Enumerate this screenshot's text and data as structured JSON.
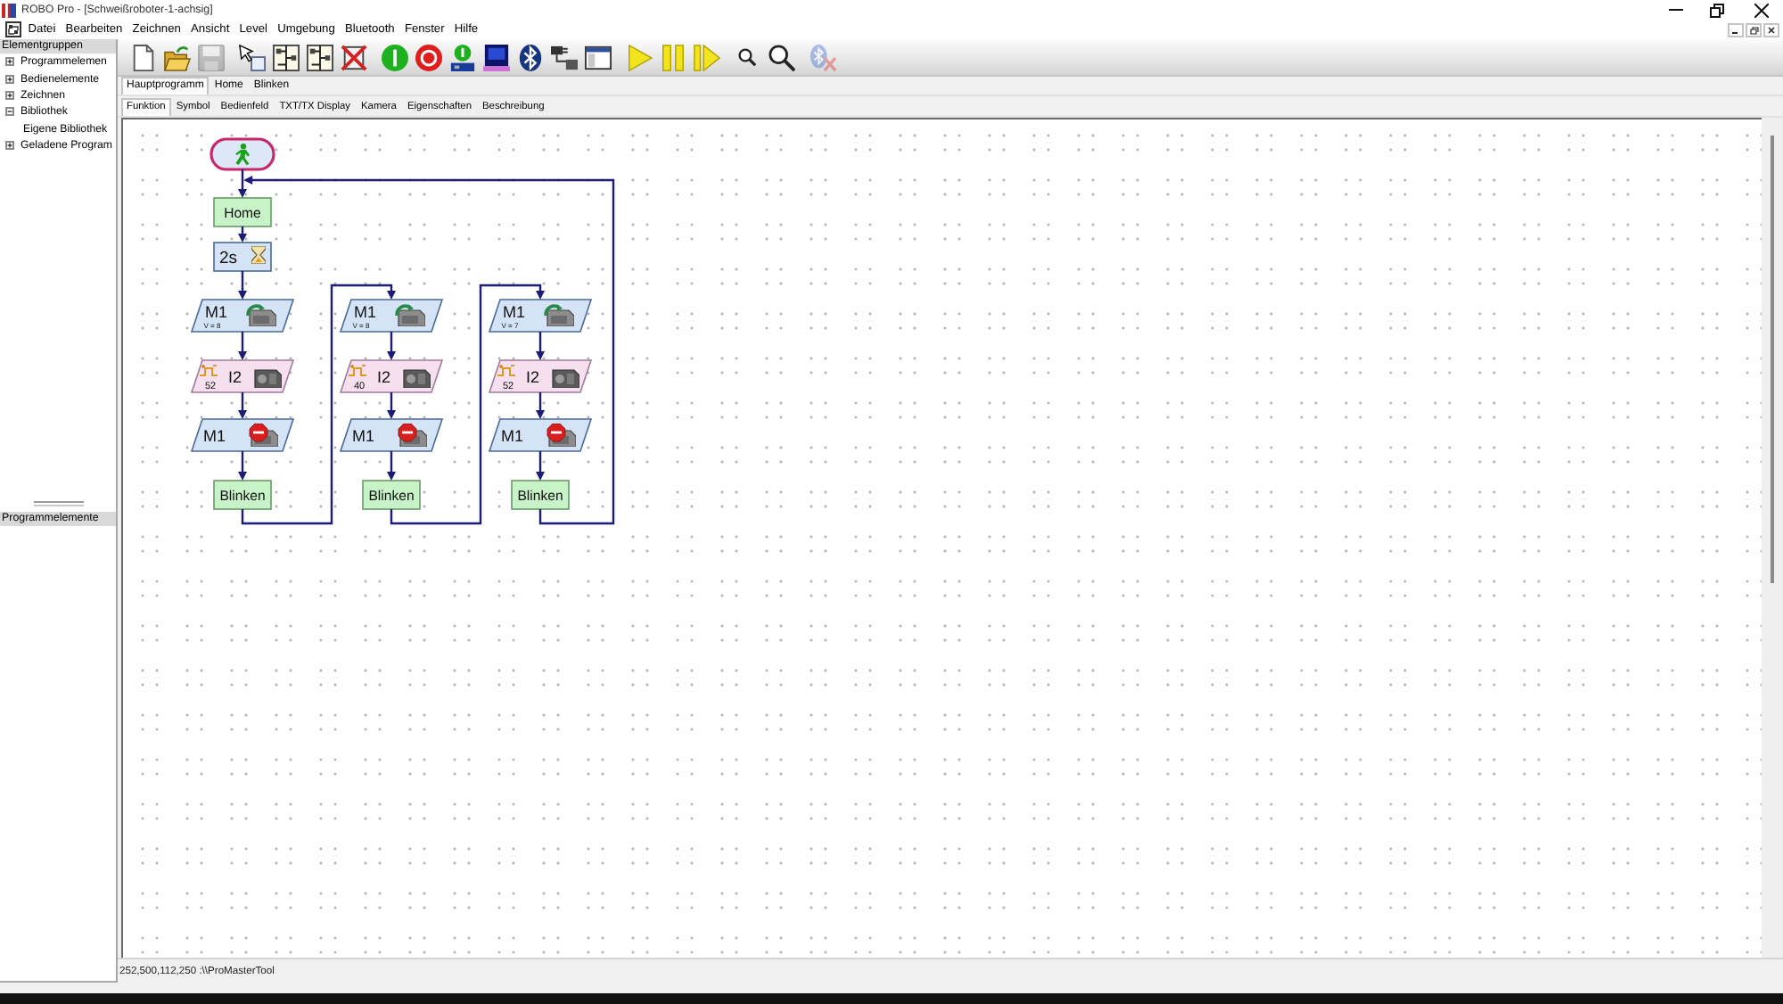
{
  "window": {
    "title": "ROBO Pro - [Schweißroboter-1-achsig]"
  },
  "menu": [
    "Datei",
    "Bearbeiten",
    "Zeichnen",
    "Ansicht",
    "Level",
    "Umgebung",
    "Bluetooth",
    "Fenster",
    "Hilfe"
  ],
  "sidebar": {
    "title": "Elementgruppen",
    "items": [
      {
        "label": "Programmelemen",
        "expanded": false
      },
      {
        "label": "Bedienelemente",
        "expanded": false
      },
      {
        "label": "Zeichnen",
        "expanded": false
      },
      {
        "label": "Bibliothek",
        "expanded": true,
        "children": [
          {
            "label": "Eigene Bibliothek"
          }
        ]
      },
      {
        "label": "Geladene Program",
        "expanded": false
      }
    ],
    "lower_title": "Programmelemente"
  },
  "toolbar": {
    "groups": [
      [
        {
          "kind": "new",
          "disabled": false
        },
        {
          "kind": "open",
          "disabled": false
        },
        {
          "kind": "save",
          "disabled": true
        }
      ],
      [
        {
          "kind": "select",
          "disabled": false
        },
        {
          "kind": "flow",
          "disabled": false
        },
        {
          "kind": "flow",
          "disabled": false
        },
        {
          "kind": "delete",
          "disabled": false
        }
      ],
      [
        {
          "kind": "start",
          "disabled": false
        },
        {
          "kind": "stop",
          "disabled": false
        },
        {
          "kind": "download",
          "disabled": false
        },
        {
          "kind": "controller",
          "disabled": false
        },
        {
          "kind": "bluetooth",
          "disabled": false
        },
        {
          "kind": "interface",
          "disabled": false
        },
        {
          "kind": "window",
          "disabled": false
        }
      ],
      [
        {
          "kind": "play",
          "disabled": false
        },
        {
          "kind": "pause",
          "disabled": false
        },
        {
          "kind": "step",
          "disabled": false
        }
      ],
      [
        {
          "kind": "zoom_small",
          "disabled": false
        },
        {
          "kind": "zoom_large",
          "disabled": false
        }
      ],
      [
        {
          "kind": "bluetooth_off",
          "disabled": true
        }
      ]
    ]
  },
  "program_tabs": [
    {
      "label": "Hauptprogramm",
      "selected": true
    },
    {
      "label": "Home",
      "selected": false
    },
    {
      "label": "Blinken",
      "selected": false
    }
  ],
  "view_tabs": [
    {
      "label": "Funktion",
      "selected": true
    },
    {
      "label": "Symbol",
      "selected": false
    },
    {
      "label": "Bedienfeld",
      "selected": false
    },
    {
      "label": "TXT/TX Display",
      "selected": false
    },
    {
      "label": "Kamera",
      "selected": false
    },
    {
      "label": "Eigenschaften",
      "selected": false
    },
    {
      "label": "Beschreibung",
      "selected": false
    }
  ],
  "flowchart": {
    "columns": [
      {
        "nodes": [
          {
            "kind": "start"
          },
          {
            "kind": "subprogram",
            "label": "Home"
          },
          {
            "kind": "wait",
            "label": "2s"
          },
          {
            "kind": "motor",
            "output": "M1",
            "speed": "V = 8"
          },
          {
            "kind": "counter",
            "count": "52",
            "input": "I2"
          },
          {
            "kind": "motor_stop",
            "output": "M1"
          },
          {
            "kind": "subprogram",
            "label": "Blinken"
          }
        ]
      },
      {
        "nodes": [
          {
            "kind": "motor",
            "output": "M1",
            "speed": "V = 8"
          },
          {
            "kind": "counter",
            "count": "40",
            "input": "I2"
          },
          {
            "kind": "motor_stop",
            "output": "M1"
          },
          {
            "kind": "subprogram",
            "label": "Blinken"
          }
        ]
      },
      {
        "nodes": [
          {
            "kind": "motor",
            "output": "M1",
            "speed": "V = 7"
          },
          {
            "kind": "counter",
            "count": "52",
            "input": "I2"
          },
          {
            "kind": "motor_stop",
            "output": "M1"
          },
          {
            "kind": "subprogram",
            "label": "Blinken"
          }
        ]
      }
    ],
    "loop": true
  },
  "status_bar": {
    "text": "252,500,112,250 :\\\\ProMasterTool"
  }
}
